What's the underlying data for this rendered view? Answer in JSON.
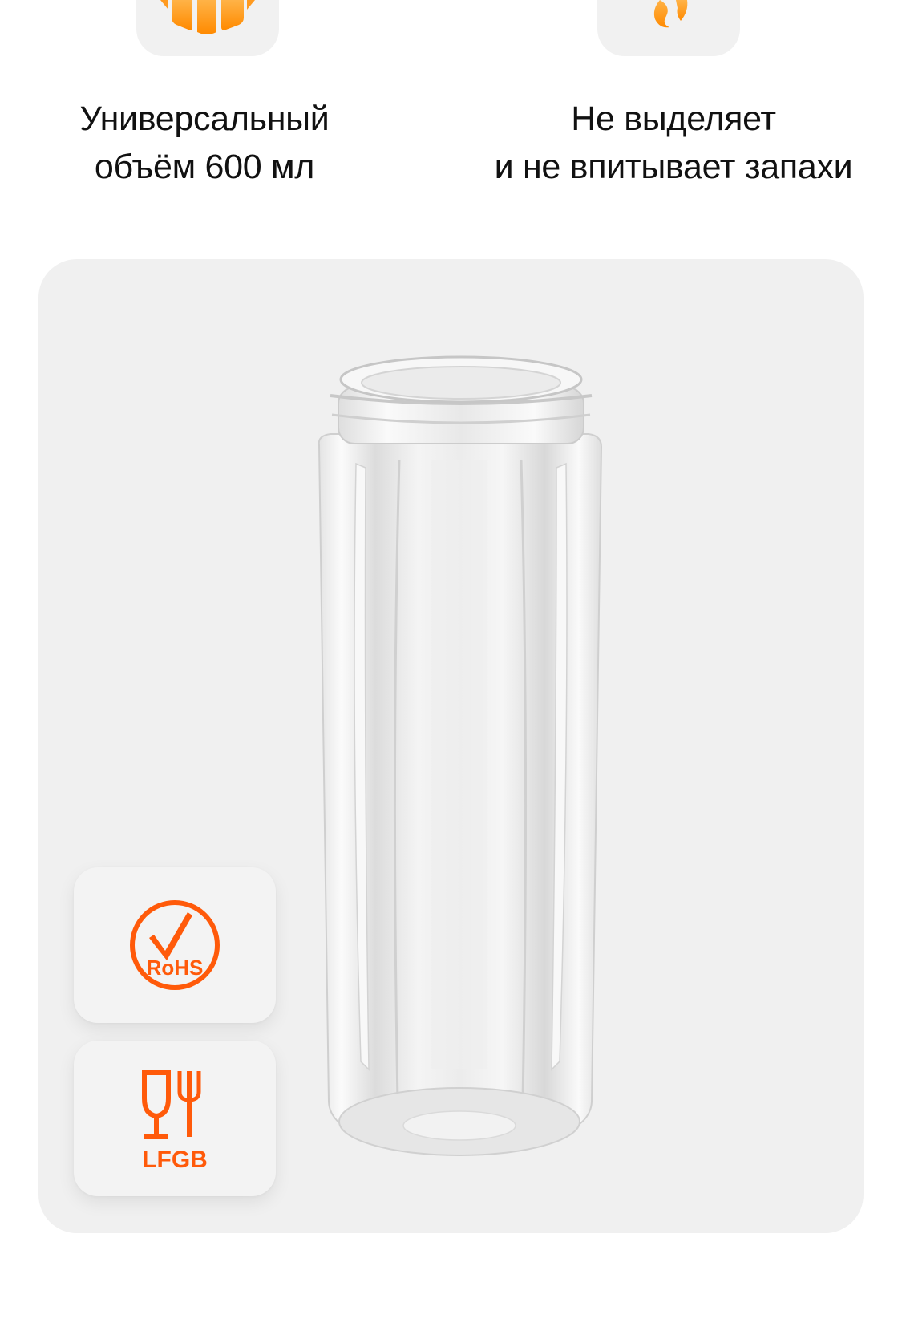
{
  "features": [
    {
      "icon": "box-icon",
      "lines": [
        "Универсальный",
        "объём 600 мл"
      ]
    },
    {
      "icon": "flame-icon",
      "lines": [
        "Не выделяет",
        "и не впитывает запахи"
      ]
    }
  ],
  "certifications": {
    "rohs": {
      "icon": "rohs-check-icon",
      "label": "RoHS"
    },
    "lfgb": {
      "icon": "glass-fork-icon",
      "label": "LFGB"
    }
  },
  "product": {
    "image": "transparent-bottle"
  },
  "colors": {
    "accent_orange": "#ff9a1f",
    "cert_orange": "#ff5a0a",
    "panel_bg": "#f0f0f0",
    "tile_bg": "#f1f1f1",
    "text": "#111111"
  }
}
